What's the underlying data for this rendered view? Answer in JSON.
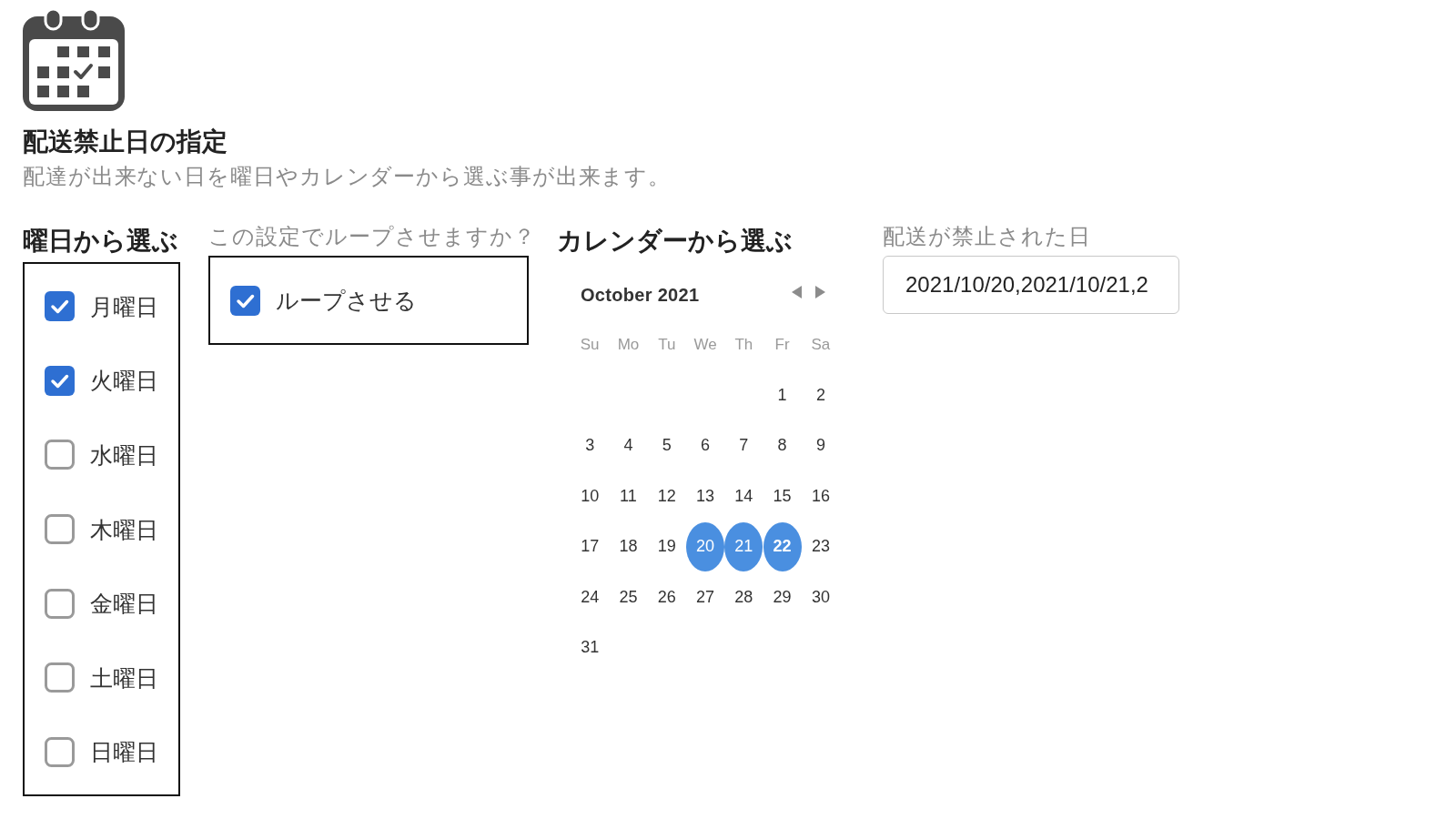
{
  "header": {
    "title": "配送禁止日の指定",
    "description": "配達が出来ない日を曜日やカレンダーから選ぶ事が出来ます。"
  },
  "weekday_section": {
    "heading": "曜日から選ぶ",
    "options": [
      {
        "label": "月曜日",
        "checked": true
      },
      {
        "label": "火曜日",
        "checked": true
      },
      {
        "label": "水曜日",
        "checked": false
      },
      {
        "label": "木曜日",
        "checked": false
      },
      {
        "label": "金曜日",
        "checked": false
      },
      {
        "label": "土曜日",
        "checked": false
      },
      {
        "label": "日曜日",
        "checked": false
      }
    ]
  },
  "loop_section": {
    "question": "この設定でループさせますか？",
    "option": {
      "label": "ループさせる",
      "checked": true
    }
  },
  "calendar": {
    "heading": "カレンダーから選ぶ",
    "month_label": "October 2021",
    "weekdays": [
      "Su",
      "Mo",
      "Tu",
      "We",
      "Th",
      "Fr",
      "Sa"
    ],
    "weeks": [
      {
        "kind": "partial_start",
        "days": [
          {
            "day": "1",
            "selected": false,
            "today": false
          },
          {
            "day": "2",
            "selected": false,
            "today": false
          }
        ]
      },
      {
        "kind": "full",
        "days": [
          {
            "day": "3",
            "selected": false,
            "today": false
          },
          {
            "day": "4",
            "selected": false,
            "today": false
          },
          {
            "day": "5",
            "selected": false,
            "today": false
          },
          {
            "day": "6",
            "selected": false,
            "today": false
          },
          {
            "day": "7",
            "selected": false,
            "today": false
          },
          {
            "day": "8",
            "selected": false,
            "today": false
          },
          {
            "day": "9",
            "selected": false,
            "today": false
          }
        ]
      },
      {
        "kind": "full",
        "days": [
          {
            "day": "10",
            "selected": false,
            "today": false
          },
          {
            "day": "11",
            "selected": false,
            "today": false
          },
          {
            "day": "12",
            "selected": false,
            "today": false
          },
          {
            "day": "13",
            "selected": false,
            "today": false
          },
          {
            "day": "14",
            "selected": false,
            "today": false
          },
          {
            "day": "15",
            "selected": false,
            "today": false
          },
          {
            "day": "16",
            "selected": false,
            "today": false
          }
        ]
      },
      {
        "kind": "full",
        "days": [
          {
            "day": "17",
            "selected": false,
            "today": false
          },
          {
            "day": "18",
            "selected": false,
            "today": false
          },
          {
            "day": "19",
            "selected": false,
            "today": false
          },
          {
            "day": "20",
            "selected": true,
            "today": false
          },
          {
            "day": "21",
            "selected": true,
            "today": false
          },
          {
            "day": "22",
            "selected": true,
            "today": true
          },
          {
            "day": "23",
            "selected": false,
            "today": false
          }
        ]
      },
      {
        "kind": "full",
        "days": [
          {
            "day": "24",
            "selected": false,
            "today": false
          },
          {
            "day": "25",
            "selected": false,
            "today": false
          },
          {
            "day": "26",
            "selected": false,
            "today": false
          },
          {
            "day": "27",
            "selected": false,
            "today": false
          },
          {
            "day": "28",
            "selected": false,
            "today": false
          },
          {
            "day": "29",
            "selected": false,
            "today": false
          },
          {
            "day": "30",
            "selected": false,
            "today": false
          }
        ]
      },
      {
        "kind": "partial_end",
        "days": [
          {
            "day": "31",
            "selected": false,
            "today": false
          }
        ]
      }
    ]
  },
  "blocked_dates": {
    "label": "配送が禁止された日",
    "value": "2021/10/20,2021/10/21,2"
  }
}
